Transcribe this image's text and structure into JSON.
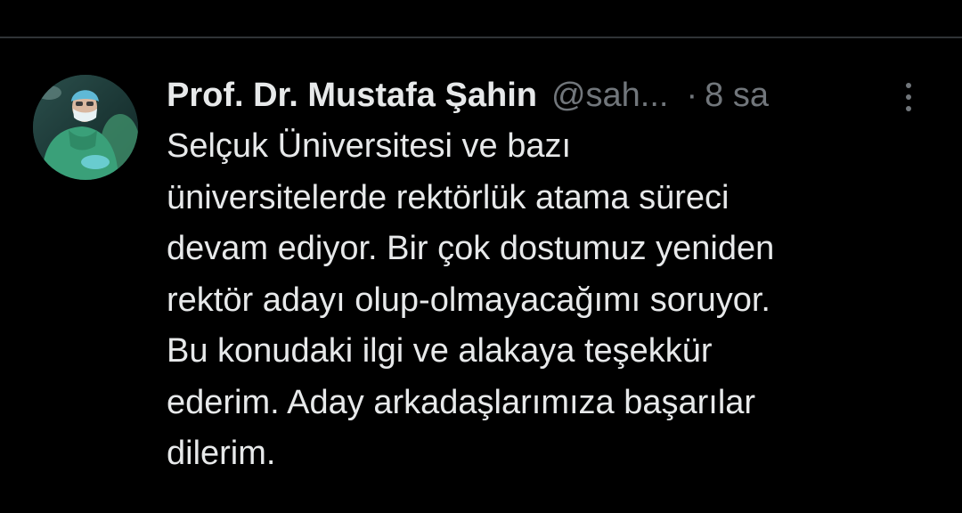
{
  "tweet": {
    "author": {
      "display_name": "Prof. Dr. Mustafa Şahin",
      "handle": "@sah...",
      "avatar_icon": "surgeon-photo-avatar"
    },
    "separator": "·",
    "time": "8 sa",
    "more_icon": "vertical-ellipsis-icon",
    "text_lines": [
      "Selçuk Üniversitesi ve bazı",
      "üniversitelerde rektörlük atama süreci",
      "devam ediyor. Bir çok dostumuz yeniden",
      "rektör adayı olup-olmayacağımı soruyor.",
      "Bu konudaki ilgi ve alakaya teşekkür",
      "ederim. Aday arkadaşlarımıza başarılar",
      "dilerim."
    ]
  },
  "colors": {
    "background": "#000000",
    "primary_text": "#e7e9ea",
    "secondary_text": "#71767b",
    "divider": "#2f3336"
  }
}
